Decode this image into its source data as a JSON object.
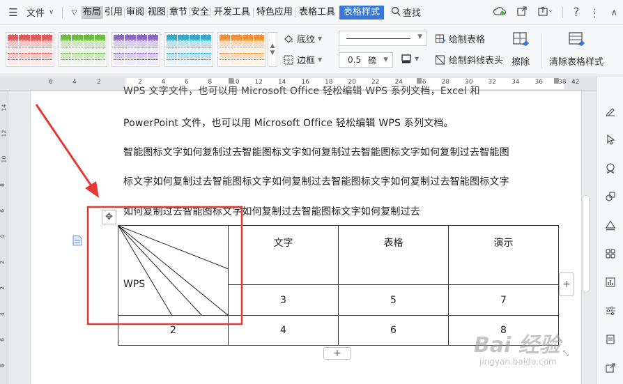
{
  "menubar": {
    "file_label": "文件",
    "tabs": [
      "布局",
      "引用",
      "审阅",
      "视图",
      "章节",
      "安全",
      "开发工具",
      "特色应用",
      "表格工具"
    ],
    "active_tab": "表格样式",
    "search_label": "查找"
  },
  "ribbon": {
    "shading_label": "底纹",
    "border_label": "边框",
    "line_weight_value": "0.5",
    "line_weight_unit": "磅",
    "draw_table_label": "绘制表格",
    "draw_diagonal_label": "绘制斜线表头",
    "erase_label": "擦除",
    "clear_style_label": "清除表格样式",
    "swatch_colors": [
      "#e05a5a",
      "#6fba44",
      "#8a6bbf",
      "#3aa7c9",
      "#f0913a"
    ]
  },
  "ruler": {
    "left_numbers": [
      "6",
      "4",
      "2"
    ],
    "right_numbers": [
      "2",
      "4",
      "6",
      "8",
      "10",
      "12",
      "14",
      "16",
      "18",
      "20",
      "22",
      "24",
      "26",
      "28",
      "30",
      "32",
      "34",
      "36",
      "38",
      "42"
    ],
    "vertical_numbers": [
      "14",
      "12",
      "10",
      "8",
      "6",
      "4",
      "2",
      "2",
      "4",
      "6",
      "8"
    ]
  },
  "document": {
    "para_cut": "WPS 文字文件，也可以用 Microsoft Office 轻松编辑 WPS 系列文档，Excel 和",
    "para1": "PowerPoint 文件，也可以用 Microsoft Office 轻松编辑 WPS 系列文档。",
    "para2": "智能图标文字如何复制过去智能图标文字如何复制过去智能图标文字如何复制过去智能图",
    "para3": "标文字如何复制过去智能图标文字如何复制过去智能图标文字如何复制过去智能图标文字",
    "para4": "如何复制过去智能图标文字如何复制过去智能图标文字如何复制过去"
  },
  "table": {
    "corner_label": "WPS",
    "headers": [
      "文字",
      "表格",
      "演示"
    ],
    "row1": [
      "3",
      "5",
      "7"
    ],
    "row2": [
      "2",
      "4",
      "6",
      "8"
    ]
  },
  "watermark": {
    "brand": "Bai 经验",
    "url": "jingyan.baidu.com"
  },
  "colors": {
    "accent": "#3a78d8",
    "annotation": "#e53935"
  }
}
